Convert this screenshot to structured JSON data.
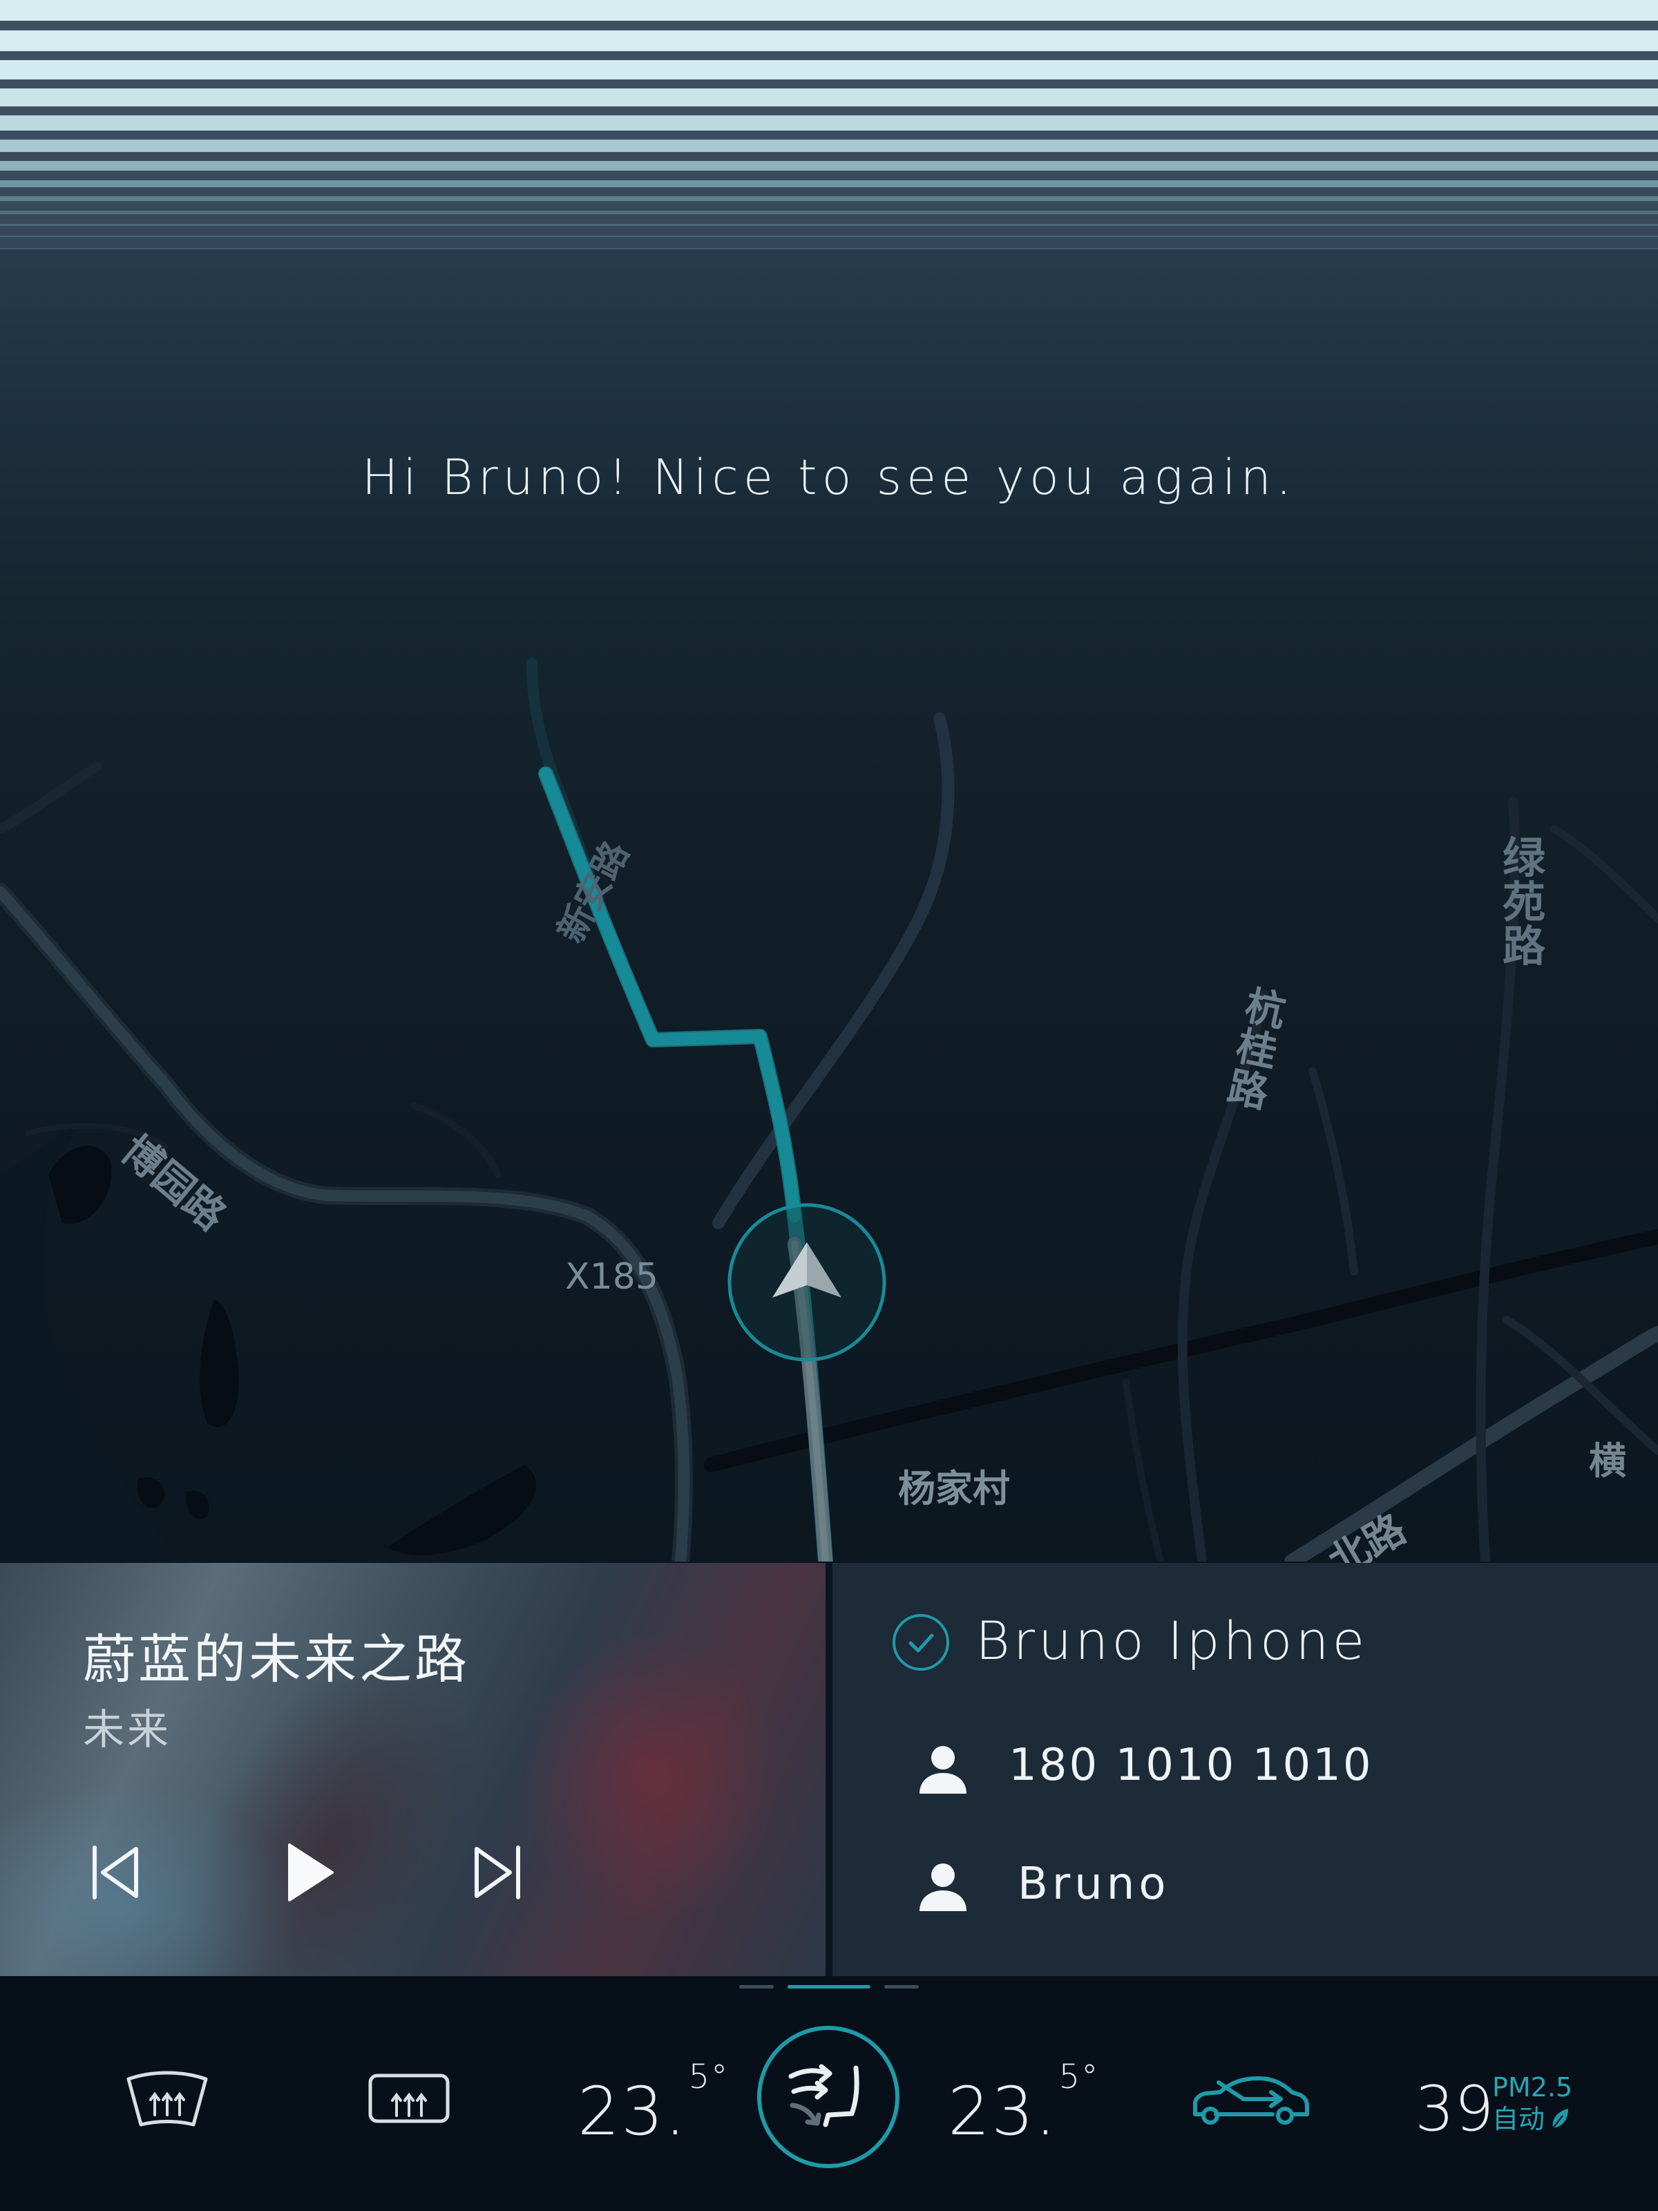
{
  "greeting": "Hi Bruno! Nice to see you again.",
  "map": {
    "road_code": "X185",
    "labels": [
      "博园路",
      "新安路",
      "杭桂路",
      "绿苑路",
      "杨家村",
      "北路",
      "横"
    ]
  },
  "music": {
    "title": "蔚蓝的未来之路",
    "artist": "未来",
    "controls": [
      "previous-icon",
      "play-icon",
      "next-icon"
    ]
  },
  "phone": {
    "device_name": "Bruno Iphone",
    "connected": true,
    "number": "180 1010 1010",
    "contact": "Bruno"
  },
  "climate": {
    "left_temp": "23.",
    "left_temp_decimal": "5°",
    "right_temp": "23.",
    "right_temp_decimal": "5°",
    "pm_value": "39",
    "pm_label": "PM2.5",
    "pm_mode": "自动"
  },
  "colors": {
    "accent": "#1f9aa8",
    "route": "#17808e",
    "background": "#0a1520"
  },
  "icons": [
    "front-defrost-icon",
    "rear-defrost-icon",
    "seat-ventilation-icon",
    "air-recirculation-icon",
    "leaf-icon",
    "check-icon",
    "person-icon",
    "navigation-arrow-icon"
  ]
}
